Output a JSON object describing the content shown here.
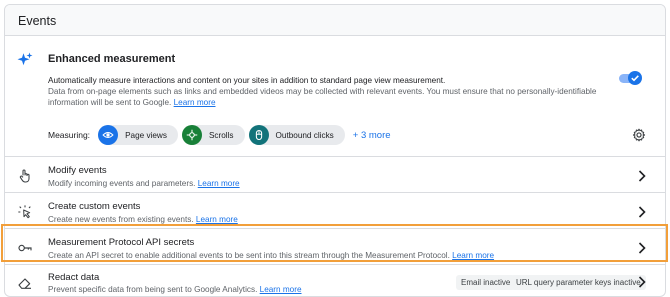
{
  "panel": {
    "title": "Events"
  },
  "enhanced": {
    "title": "Enhanced measurement",
    "desc_line1": "Automatically measure interactions and content on your sites in addition to standard page view measurement.",
    "desc_line2": "Data from on-page elements such as links and embedded videos may be collected with relevant events. You must ensure that no personally-identifiable information will be sent to Google.",
    "learn_more": "Learn more",
    "enabled": true,
    "measuring_label": "Measuring:",
    "chips": [
      {
        "label": "Page views",
        "icon": "eye-icon",
        "color": "#1a73e8"
      },
      {
        "label": "Scrolls",
        "icon": "crosshair-icon",
        "color": "#188038"
      },
      {
        "label": "Outbound clicks",
        "icon": "mouse-icon",
        "color": "#12737a"
      }
    ],
    "more_label": "+ 3 more"
  },
  "rows": [
    {
      "title": "Modify events",
      "subtitle": "Modify incoming events and parameters.",
      "link": "Learn more",
      "icon": "touch-hand-icon"
    },
    {
      "title": "Create custom events",
      "subtitle": "Create new events from existing events.",
      "link": "Learn more",
      "icon": "sparkle-click-icon"
    },
    {
      "title": "Measurement Protocol API secrets",
      "subtitle": "Create an API secret to enable additional events to be sent into this stream through the Measurement Protocol.",
      "link": "Learn more",
      "icon": "key-icon"
    },
    {
      "title": "Redact data",
      "subtitle": "Prevent specific data from being sent to Google Analytics.",
      "link": "Learn more",
      "icon": "eraser-icon",
      "tags": [
        "Email inactive",
        "URL query parameter keys inactive"
      ]
    }
  ],
  "colors": {
    "accent": "#1a73e8",
    "highlight": "#f29f3a"
  }
}
